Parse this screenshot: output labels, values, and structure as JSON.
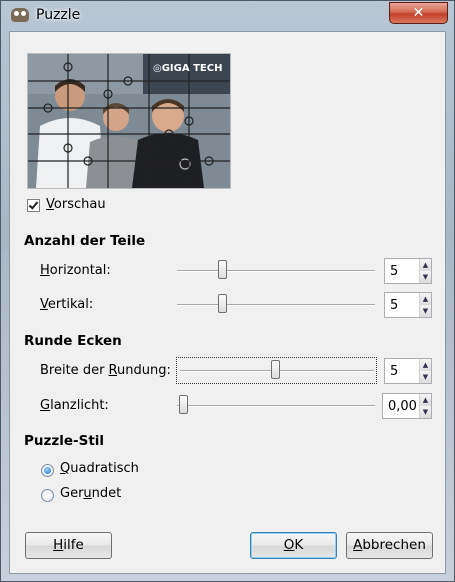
{
  "window": {
    "title": "Puzzle",
    "close_glyph": "✕"
  },
  "preview": {
    "logo": "◎GIGA TECH"
  },
  "preview_checkbox": {
    "label_u": "V",
    "label_rest": "orschau",
    "checked": true
  },
  "pieces": {
    "heading": "Anzahl der Teile",
    "horizontal": {
      "label_u": "H",
      "label_rest": "orizontal:",
      "value": "5",
      "level": 0.22
    },
    "vertical": {
      "label_u": "V",
      "label_rest": "ertikal:",
      "value": "5",
      "level": 0.22
    }
  },
  "round_corners": {
    "heading": "Runde Ecken",
    "width": {
      "label_pre": "Breite der ",
      "label_u": "R",
      "label_rest": "undung:",
      "value": "5",
      "level": 0.5
    },
    "highlight": {
      "label_u": "G",
      "label_rest": "lanzlicht:",
      "value": "0,00",
      "level": 0.0
    }
  },
  "style": {
    "heading": "Puzzle-Stil",
    "options": [
      {
        "pre": "",
        "u": "Q",
        "rest": "uadratisch",
        "selected": true
      },
      {
        "pre": "Ger",
        "u": "u",
        "rest": "ndet",
        "selected": false
      }
    ]
  },
  "buttons": {
    "help": {
      "u": "H",
      "rest": "ilfe"
    },
    "ok": {
      "u": "O",
      "rest": "K"
    },
    "cancel": {
      "u": "A",
      "rest": "bbrechen"
    }
  },
  "colors": {
    "close_red": "#c1412b",
    "default_blue": "#3c7fb1"
  }
}
